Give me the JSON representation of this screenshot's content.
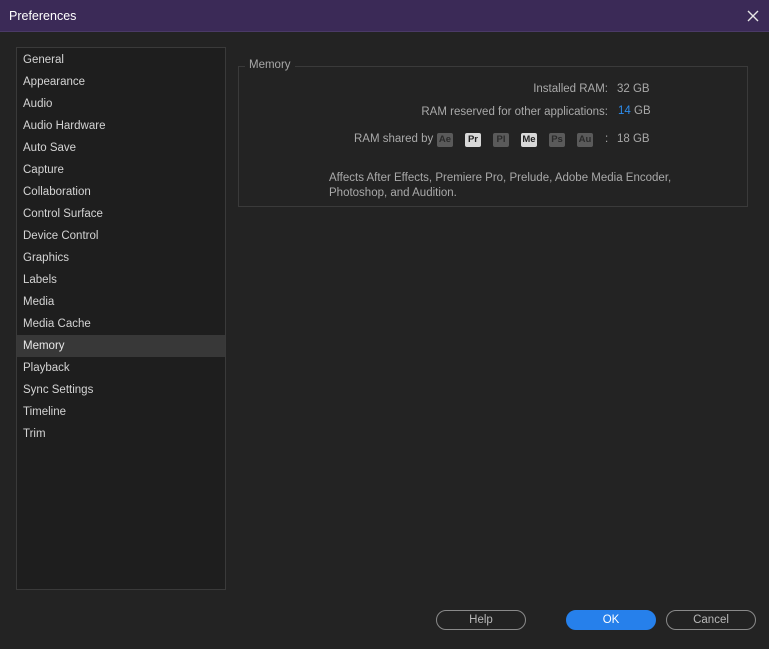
{
  "window": {
    "title": "Preferences",
    "close_icon": "close-icon"
  },
  "sidebar": {
    "items": [
      {
        "label": "General"
      },
      {
        "label": "Appearance"
      },
      {
        "label": "Audio"
      },
      {
        "label": "Audio Hardware"
      },
      {
        "label": "Auto Save"
      },
      {
        "label": "Capture"
      },
      {
        "label": "Collaboration"
      },
      {
        "label": "Control Surface"
      },
      {
        "label": "Device Control"
      },
      {
        "label": "Graphics"
      },
      {
        "label": "Labels"
      },
      {
        "label": "Media"
      },
      {
        "label": "Media Cache"
      },
      {
        "label": "Memory"
      },
      {
        "label": "Playback"
      },
      {
        "label": "Sync Settings"
      },
      {
        "label": "Timeline"
      },
      {
        "label": "Trim"
      }
    ],
    "selected": "Memory"
  },
  "memory": {
    "group_title": "Memory",
    "installed_label": "Installed RAM:",
    "installed_value": "32 GB",
    "reserved_label": "RAM reserved for other applications:",
    "reserved_number": "14",
    "reserved_unit": "GB",
    "shared_label": "RAM shared by",
    "apps": [
      {
        "abbr": "Ae",
        "active": false
      },
      {
        "abbr": "Pr",
        "active": true
      },
      {
        "abbr": "Pl",
        "active": false
      },
      {
        "abbr": "Me",
        "active": true
      },
      {
        "abbr": "Ps",
        "active": false
      },
      {
        "abbr": "Au",
        "active": false
      }
    ],
    "shared_separator": ":",
    "shared_value": "18 GB",
    "note": "Affects After Effects, Premiere Pro, Prelude, Adobe Media Encoder, Photoshop, and Audition."
  },
  "buttons": {
    "help": "Help",
    "ok": "OK",
    "cancel": "Cancel"
  },
  "colors": {
    "titlebar": "#3b2a57",
    "accent": "#2680eb",
    "background": "#232323"
  }
}
